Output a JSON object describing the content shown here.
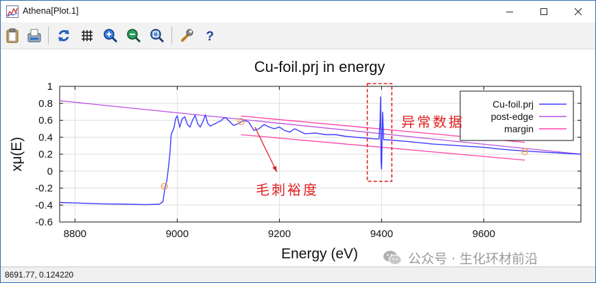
{
  "window": {
    "title": "Athena[Plot.1]",
    "controls": {
      "minimize": "–",
      "maximize": "☐",
      "close": "✕"
    }
  },
  "toolbar": {
    "buttons": [
      {
        "name": "clipboard-icon",
        "tooltip": ""
      },
      {
        "name": "save-icon",
        "tooltip": ""
      },
      {
        "name": "refresh-icon",
        "tooltip": ""
      },
      {
        "name": "grid-icon",
        "tooltip": ""
      },
      {
        "name": "zoom-in-icon",
        "tooltip": ""
      },
      {
        "name": "zoom-out-icon",
        "tooltip": ""
      },
      {
        "name": "zoom-reset-icon",
        "tooltip": ""
      },
      {
        "name": "wrench-icon",
        "tooltip": ""
      },
      {
        "name": "help-icon",
        "tooltip": ""
      }
    ]
  },
  "chart_data": {
    "type": "line",
    "title": "Cu-foil.prj in energy",
    "xlabel": "Energy    (eV)",
    "ylabel": "xμ(E)",
    "xlim": [
      8770,
      9790
    ],
    "ylim": [
      -0.6,
      1.0
    ],
    "x_ticks": [
      8800,
      9000,
      9200,
      9400,
      9600
    ],
    "y_ticks": [
      -0.6,
      -0.4,
      -0.2,
      0,
      0.2,
      0.4,
      0.6,
      0.8,
      1
    ],
    "y_tick_labels": [
      "-0.6",
      "-0.4",
      "-0.2",
      "0",
      "0.2",
      "0.4",
      "0.6",
      "0.8",
      "1"
    ],
    "grid": true,
    "legend_position": "top-right",
    "series": [
      {
        "name": "Cu-foil.prj",
        "color": "#3a3aff",
        "x": [
          8770,
          8800,
          8850,
          8900,
          8940,
          8965,
          8972,
          8976,
          8980,
          8983,
          8986,
          8988,
          8990,
          8993,
          8995,
          8997,
          9000,
          9005,
          9010,
          9015,
          9020,
          9025,
          9030,
          9035,
          9040,
          9045,
          9050,
          9055,
          9060,
          9065,
          9070,
          9075,
          9080,
          9085,
          9090,
          9095,
          9100,
          9110,
          9120,
          9130,
          9140,
          9150,
          9160,
          9170,
          9180,
          9190,
          9200,
          9210,
          9220,
          9230,
          9240,
          9250,
          9270,
          9290,
          9310,
          9330,
          9350,
          9370,
          9385,
          9395,
          9397,
          9398,
          9399,
          9400,
          9401,
          9402,
          9404,
          9410,
          9450,
          9500,
          9550,
          9600,
          9650,
          9700,
          9790
        ],
        "y": [
          -0.37,
          -0.375,
          -0.385,
          -0.39,
          -0.395,
          -0.39,
          -0.36,
          -0.2,
          -0.1,
          0.05,
          0.22,
          0.42,
          0.46,
          0.5,
          0.55,
          0.62,
          0.65,
          0.52,
          0.62,
          0.64,
          0.55,
          0.52,
          0.6,
          0.66,
          0.56,
          0.52,
          0.58,
          0.66,
          0.56,
          0.53,
          0.55,
          0.56,
          0.58,
          0.59,
          0.62,
          0.63,
          0.6,
          0.54,
          0.56,
          0.6,
          0.58,
          0.48,
          0.5,
          0.55,
          0.52,
          0.5,
          0.52,
          0.48,
          0.46,
          0.5,
          0.47,
          0.44,
          0.45,
          0.43,
          0.43,
          0.41,
          0.4,
          0.39,
          0.38,
          0.38,
          0.6,
          0.88,
          0.1,
          0.02,
          0.42,
          0.7,
          0.37,
          0.37,
          0.35,
          0.32,
          0.3,
          0.28,
          0.25,
          0.23,
          0.2
        ]
      },
      {
        "name": "post-edge",
        "color": "#b84fe0",
        "x": [
          8770,
          9790
        ],
        "y": [
          0.83,
          0.2
        ]
      },
      {
        "name": "margin",
        "color": "#ff3fa8",
        "segments": [
          {
            "x": [
              9125,
              9680
            ],
            "y": [
              0.65,
              0.34
            ]
          },
          {
            "x": [
              9125,
              9680
            ],
            "y": [
              0.43,
              0.13
            ]
          }
        ]
      }
    ],
    "markers": {
      "color": "#f0a050",
      "points": [
        {
          "x": 8975,
          "y": -0.18
        },
        {
          "x": 9125,
          "y": 0.585
        },
        {
          "x": 9680,
          "y": 0.23
        }
      ]
    },
    "annotations": {
      "anomaly_label": "异常数据",
      "burr_label": "毛刺裕度",
      "color": "#e02020",
      "anomaly_box": {
        "x": [
          9372,
          9420
        ],
        "y": [
          -0.12,
          1.0
        ]
      },
      "arrow": {
        "from": {
          "x": 9152,
          "y": 0.52
        },
        "to": {
          "x": 9195,
          "y": -0.01
        }
      }
    }
  },
  "status": {
    "coordinates": "8691.77,  0.124220"
  },
  "watermark": {
    "text": "公众号 · 生化环材前沿"
  }
}
